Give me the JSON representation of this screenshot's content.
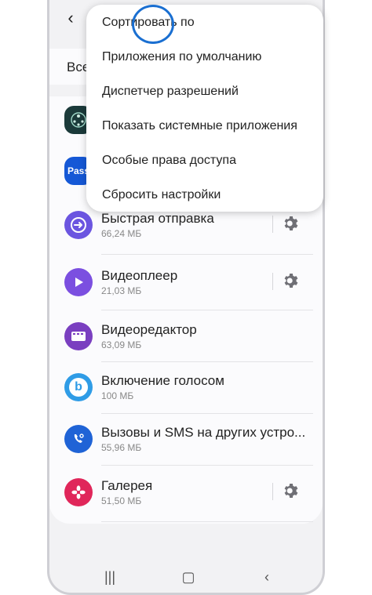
{
  "header": {
    "back_glyph": "‹",
    "title_fragment": "<"
  },
  "search": {
    "text": "Все"
  },
  "menu": {
    "items": [
      "Сортировать по",
      "Приложения по умолчанию",
      "Диспетчер разрешений",
      "Показать системные приложения",
      "Особые права доступа",
      "Сбросить настройки"
    ]
  },
  "apps": [
    {
      "name": "",
      "size": "",
      "icon": "accessibility-app-icon",
      "color": "#1b3a3a"
    },
    {
      "name": "",
      "size": "",
      "icon": "samsung-pass-icon",
      "color": "#1558d6"
    },
    {
      "name": "Быстрая отправка",
      "size": "66,24 МБ",
      "icon": "quick-share-icon",
      "color": "#6b55e0"
    },
    {
      "name": "Видеоплеер",
      "size": "21,03 МБ",
      "icon": "video-player-icon",
      "color": "#7b4fe0"
    },
    {
      "name": "Видеоредактор",
      "size": "63,09 МБ",
      "icon": "video-editor-icon",
      "color": "#7a3fc0"
    },
    {
      "name": "Включение голосом",
      "size": "100 МБ",
      "icon": "bixby-voice-icon",
      "color": "#2f9ce6"
    },
    {
      "name": "Вызовы и SMS на других устро...",
      "size": "55,96 МБ",
      "icon": "calls-sms-icon",
      "color": "#1f63d6"
    },
    {
      "name": "Галерея",
      "size": "51,50 МБ",
      "icon": "gallery-icon",
      "color": "#e0265a"
    }
  ],
  "colors": {
    "accent_ring": "#1a6fd1"
  }
}
